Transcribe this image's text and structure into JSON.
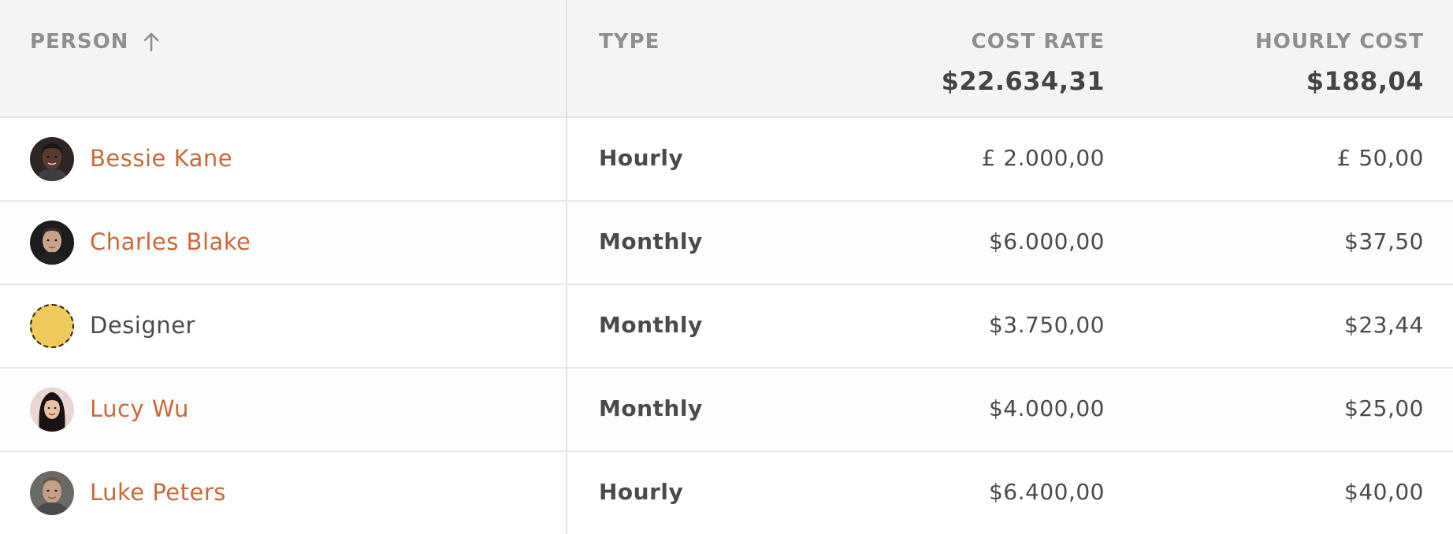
{
  "header": {
    "person_label": "PERSON",
    "type_label": "TYPE",
    "cost_rate_label": "COST RATE",
    "hourly_cost_label": "HOURLY COST",
    "cost_rate_total": "$22.634,31",
    "hourly_cost_total": "$188,04",
    "sort_icon": "arrow-up-icon"
  },
  "rows": [
    {
      "name": "Bessie Kane",
      "type": "Hourly",
      "cost_rate": "£ 2.000,00",
      "hourly_cost": "£ 50,00",
      "avatar": "photo",
      "link": true
    },
    {
      "name": "Charles Blake",
      "type": "Monthly",
      "cost_rate": "$6.000,00",
      "hourly_cost": "$37,50",
      "avatar": "photo",
      "link": true
    },
    {
      "name": "Designer",
      "type": "Monthly",
      "cost_rate": "$3.750,00",
      "hourly_cost": "$23,44",
      "avatar": "placeholder",
      "link": false
    },
    {
      "name": "Lucy Wu",
      "type": "Monthly",
      "cost_rate": "$4.000,00",
      "hourly_cost": "$25,00",
      "avatar": "photo",
      "link": true
    },
    {
      "name": "Luke Peters",
      "type": "Hourly",
      "cost_rate": "$6.400,00",
      "hourly_cost": "$40,00",
      "avatar": "photo",
      "link": true
    }
  ],
  "colors": {
    "link": "#c8693c",
    "placeholder_avatar": "#f0cb5c",
    "header_bg": "#f4f4f4"
  }
}
